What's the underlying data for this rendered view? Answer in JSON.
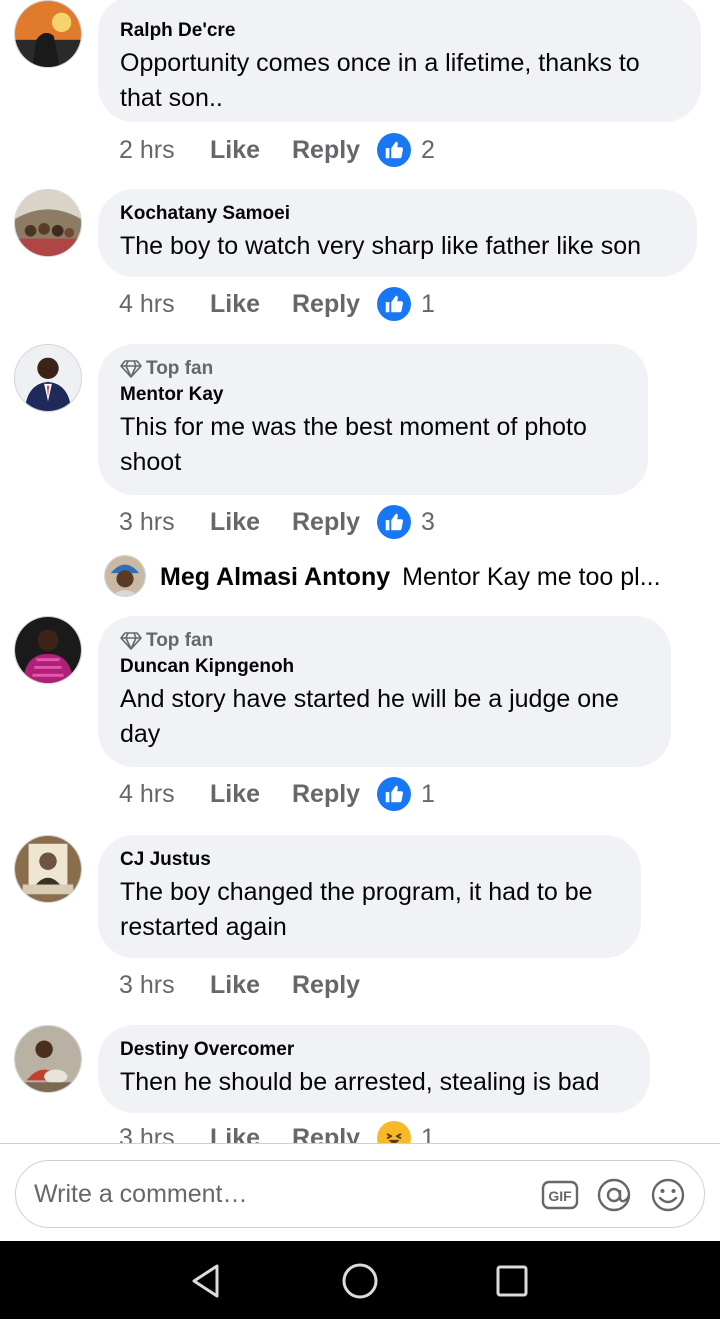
{
  "comments": [
    {
      "author": "Ralph De'cre",
      "top_fan": false,
      "text": "Opportunity comes once in a lifetime, thanks to that son..",
      "time": "2 hrs",
      "like_label": "Like",
      "reply_label": "Reply",
      "reaction": "like",
      "reaction_count": "2"
    },
    {
      "author": "Kochatany Samoei",
      "top_fan": false,
      "text": "The boy to watch very sharp like father like son",
      "time": "4 hrs",
      "like_label": "Like",
      "reply_label": "Reply",
      "reaction": "like",
      "reaction_count": "1"
    },
    {
      "author": "Mentor Kay",
      "top_fan": true,
      "badge_label": "Top fan",
      "text": "This for me was the best moment of photo shoot",
      "time": "3 hrs",
      "like_label": "Like",
      "reply_label": "Reply",
      "reaction": "like",
      "reaction_count": "3"
    },
    {
      "author": "Duncan Kipngenoh",
      "top_fan": true,
      "badge_label": "Top fan",
      "text": "And story have started he will be a judge one day",
      "time": "4 hrs",
      "like_label": "Like",
      "reply_label": "Reply",
      "reaction": "like",
      "reaction_count": "1"
    },
    {
      "author": "CJ Justus",
      "top_fan": false,
      "text": "The boy changed the program, it had to be restarted again",
      "time": "3 hrs",
      "like_label": "Like",
      "reply_label": "Reply",
      "reaction": null,
      "reaction_count": null
    },
    {
      "author": "Destiny Overcomer",
      "top_fan": false,
      "text": "Then he should be arrested, stealing is bad",
      "time": "3 hrs",
      "like_label": "Like",
      "reply_label": "Reply",
      "reaction": "haha",
      "reaction_count": "1"
    }
  ],
  "reply_preview": {
    "author": "Meg Almasi Antony",
    "text": "Mentor Kay me too pl..."
  },
  "composer": {
    "placeholder": "Write a comment…",
    "tools": [
      "gif-icon",
      "mention-icon",
      "emoji-icon"
    ],
    "gif_label": "GIF"
  },
  "colors": {
    "bubble": "#f0f2f5",
    "secondary_text": "#65676b",
    "like_blue": "#1877f2",
    "haha_yellow": "#f7b928"
  }
}
